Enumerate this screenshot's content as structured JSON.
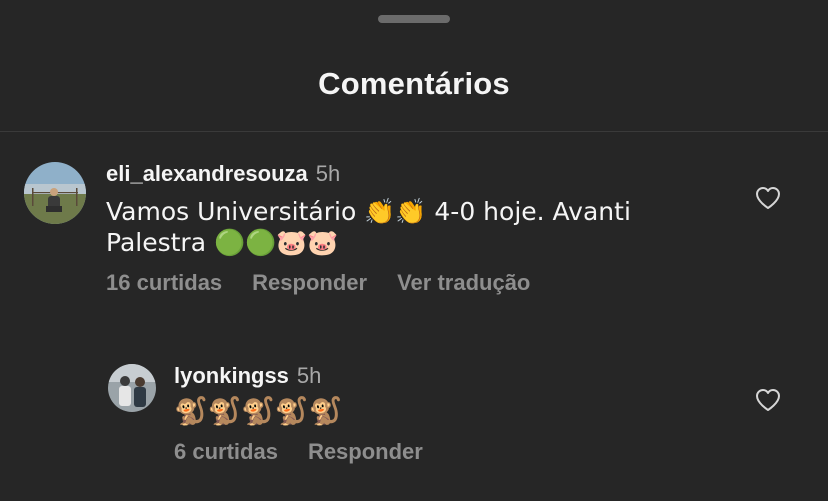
{
  "sheet": {
    "title": "Comentários"
  },
  "comments": [
    {
      "username": "eli_alexandresouza",
      "time": "5h",
      "text": "Vamos Universitário 👏👏 4-0 hoje. Avanti\nPalestra 🟢🟢🐷🐷",
      "likes_label": "16 curtidas",
      "reply_label": "Responder",
      "translate_label": "Ver tradução"
    },
    {
      "username": "lyonkingss",
      "time": "5h",
      "text": "🐒🐒🐒🐒🐒",
      "likes_label": "6 curtidas",
      "reply_label": "Responder"
    }
  ],
  "icons": {
    "like": "heart-outline-icon",
    "grabber": "drag-handle"
  },
  "colors": {
    "background": "#262626",
    "primary_text": "#f5f5f5",
    "secondary_text": "#8e8e8e"
  }
}
